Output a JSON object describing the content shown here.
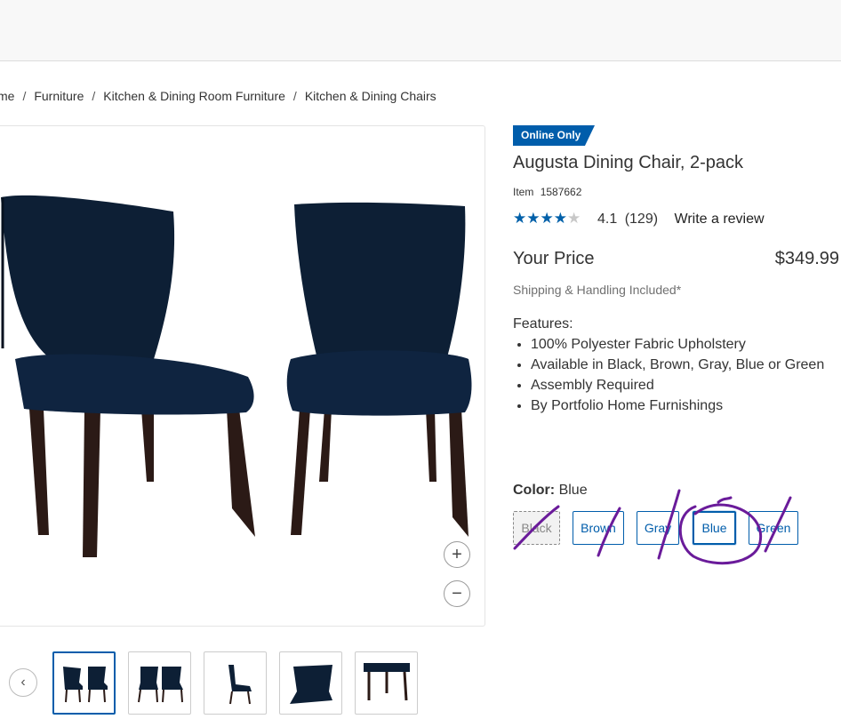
{
  "breadcrumb": [
    "me",
    "Furniture",
    "Kitchen & Dining Room Furniture",
    "Kitchen & Dining Chairs"
  ],
  "product": {
    "badge": "Online Only",
    "title": "Augusta Dining Chair, 2-pack",
    "item_label": "Item",
    "item_number": "1587662",
    "rating": 4.1,
    "rating_text": "4.1",
    "review_count": "(129)",
    "write_review": "Write a review",
    "price_label": "Your Price",
    "price": "$349.99",
    "shipping": "Shipping & Handling Included*",
    "features_label": "Features:",
    "features": [
      "100% Polyester Fabric Upholstery",
      "Available in Black, Brown, Gray, Blue or Green",
      "Assembly Required",
      "By Portfolio Home Furnishings"
    ],
    "color_label": "Color:",
    "color_value": "Blue",
    "colors": [
      "Black",
      "Brown",
      "Gray",
      "Blue",
      "Green"
    ],
    "selected_color": "Blue"
  },
  "gallery": {
    "zoom_in": "+",
    "zoom_out": "−",
    "prev": "‹",
    "thumbnail_count": 5
  },
  "colors": {
    "accent": "#005dab",
    "chair": "#0d1f35",
    "legs": "#2b1a16",
    "annotation": "#6a1b9a"
  },
  "icons": [
    "plus-icon",
    "minus-icon",
    "chevron-left-icon",
    "star-icon"
  ]
}
